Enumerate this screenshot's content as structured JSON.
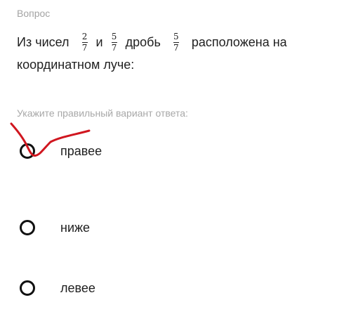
{
  "question": {
    "label": "Вопрос",
    "text_part1": "Из чисел",
    "frac1": {
      "num": "2",
      "den": "7"
    },
    "text_part2": "и",
    "frac2": {
      "num": "5",
      "den": "7"
    },
    "text_part3": "дробь",
    "frac3": {
      "num": "5",
      "den": "7"
    },
    "text_part4": "расположена на",
    "text_line2": "координатном луче:"
  },
  "hint": "Укажите правильный вариант ответа:",
  "options": [
    {
      "label": "правее"
    },
    {
      "label": "ниже"
    },
    {
      "label": "левее"
    }
  ],
  "colors": {
    "annotation": "#d0161f",
    "muted_text": "#a3a3a3"
  },
  "annotation_icon": "red-checkmark-scribble"
}
